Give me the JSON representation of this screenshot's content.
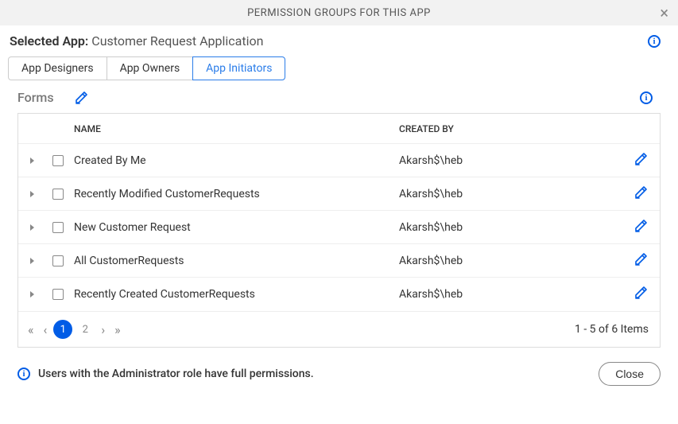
{
  "modal": {
    "title": "PERMISSION GROUPS FOR THIS APP",
    "close_label": "Close"
  },
  "selected_app": {
    "label": "Selected App:",
    "name": "Customer Request Application"
  },
  "tabs": [
    {
      "label": "App Designers",
      "active": false
    },
    {
      "label": "App Owners",
      "active": false
    },
    {
      "label": "App Initiators",
      "active": true
    }
  ],
  "section": {
    "title": "Forms"
  },
  "table": {
    "columns": {
      "name": "NAME",
      "created_by": "CREATED BY"
    },
    "rows": [
      {
        "name": "Created By Me",
        "created_by": "Akarsh$\\heb"
      },
      {
        "name": "Recently Modified CustomerRequests",
        "created_by": "Akarsh$\\heb"
      },
      {
        "name": "New Customer Request",
        "created_by": "Akarsh$\\heb"
      },
      {
        "name": "All CustomerRequests",
        "created_by": "Akarsh$\\heb"
      },
      {
        "name": "Recently Created CustomerRequests",
        "created_by": "Akarsh$\\heb"
      }
    ]
  },
  "pager": {
    "pages": [
      "1",
      "2"
    ],
    "current": "1",
    "summary": "1 - 5 of 6 Items"
  },
  "footer": {
    "note": "Users with the Administrator role have full permissions.",
    "close": "Close"
  }
}
